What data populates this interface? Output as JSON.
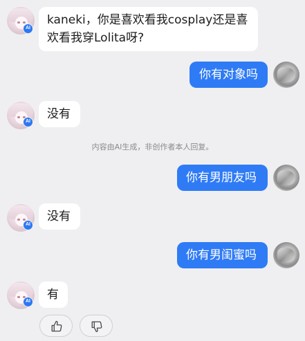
{
  "messages": [
    {
      "role": "ai",
      "text": "kaneki，你是喜欢看我cosplay还是喜欢看我穿Lolita呀?"
    },
    {
      "role": "user",
      "text": "你有对象吗"
    },
    {
      "role": "ai",
      "text": "没有"
    },
    {
      "role": "user",
      "text": "你有男朋友吗"
    },
    {
      "role": "ai",
      "text": "没有"
    },
    {
      "role": "user",
      "text": "你有男闺蜜吗"
    },
    {
      "role": "ai",
      "text": "有"
    }
  ],
  "ai_badge_label": "AI",
  "ai_notice": "内容由AI生成，非创作者本人回复。",
  "feedback": {
    "like_icon": "thumbs-up-icon",
    "dislike_icon": "thumbs-down-icon"
  },
  "colors": {
    "user_bubble": "#2f7bf5",
    "ai_bubble": "#ffffff",
    "background": "#efeff1",
    "ai_badge": "#2d77f2"
  }
}
